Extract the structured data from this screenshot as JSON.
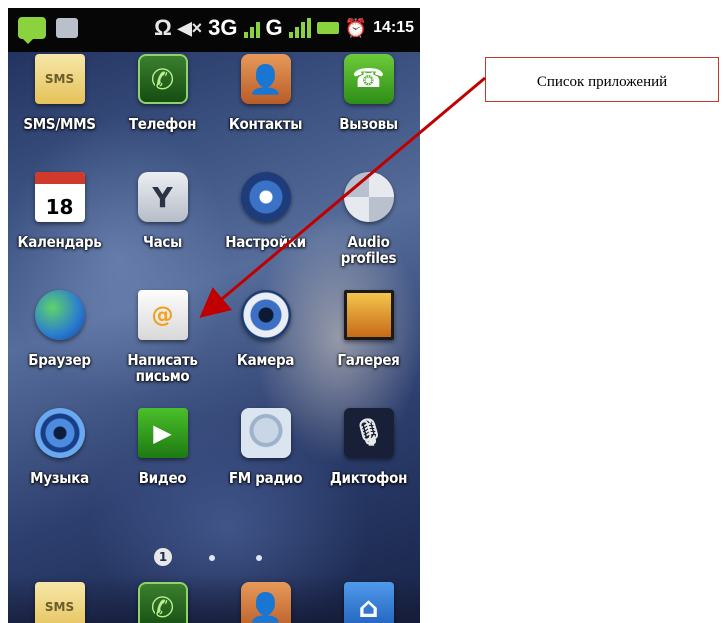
{
  "status_bar": {
    "network_3g": "3G",
    "network_g": "G",
    "time": "14:15"
  },
  "apps": [
    {
      "label": "SMS/MMS",
      "icon": "sms-envelope-icon",
      "glyph": "SMS"
    },
    {
      "label": "Телефон",
      "icon": "phone-handset-icon",
      "glyph": "✆"
    },
    {
      "label": "Контакты",
      "icon": "contacts-book-icon",
      "glyph": "👤"
    },
    {
      "label": "Вызовы",
      "icon": "call-log-icon",
      "glyph": "☎"
    },
    {
      "label": "Календарь",
      "icon": "calendar-icon",
      "glyph": "18"
    },
    {
      "label": "Часы",
      "icon": "clock-icon",
      "glyph": "Y"
    },
    {
      "label": "Настройки",
      "icon": "settings-gear-icon",
      "glyph": ""
    },
    {
      "label": "Audio\nprofiles",
      "icon": "audio-profiles-icon",
      "glyph": ""
    },
    {
      "label": "Браузер",
      "icon": "browser-globe-icon",
      "glyph": ""
    },
    {
      "label": "Написать\nписьмо",
      "icon": "email-envelope-icon",
      "glyph": "@"
    },
    {
      "label": "Камера",
      "icon": "camera-lens-icon",
      "glyph": ""
    },
    {
      "label": "Галерея",
      "icon": "gallery-picture-icon",
      "glyph": ""
    },
    {
      "label": "Музыка",
      "icon": "music-speaker-icon",
      "glyph": ""
    },
    {
      "label": "Видео",
      "icon": "video-play-icon",
      "glyph": "▶"
    },
    {
      "label": "FM радио",
      "icon": "fm-radio-icon",
      "glyph": ""
    },
    {
      "label": "Диктофон",
      "icon": "voice-recorder-mic-icon",
      "glyph": "🎙"
    }
  ],
  "pager": {
    "current_page": "1"
  },
  "dock": [
    {
      "icon": "sms-envelope-icon",
      "glyph": "SMS"
    },
    {
      "icon": "phone-handset-icon",
      "glyph": "✆"
    },
    {
      "icon": "contacts-book-icon",
      "glyph": "👤"
    },
    {
      "icon": "home-icon",
      "glyph": "⌂"
    }
  ],
  "callout": {
    "text": "Список приложений",
    "border_color": "#c0392b",
    "arrow_color": "#c00000"
  }
}
